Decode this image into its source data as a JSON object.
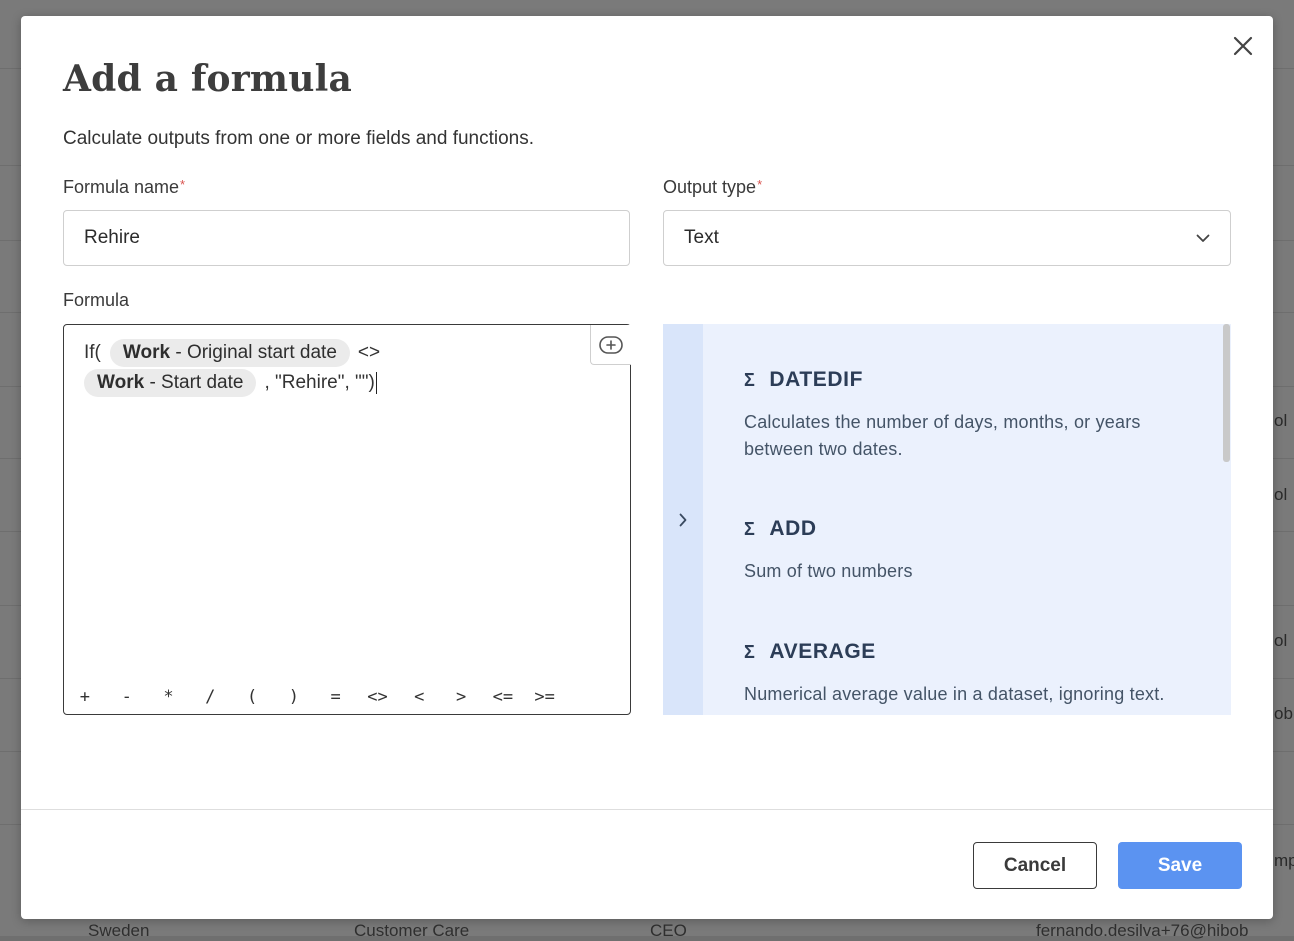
{
  "background": {
    "bottom_row": [
      "Sweden",
      "Customer Care",
      "CEO",
      "fernando.desilva+76@hibob"
    ],
    "edge_fragments": [
      "ol",
      "ol",
      "ol",
      "ob.",
      "mp"
    ]
  },
  "dialog": {
    "title": "Add a formula",
    "subtitle": "Calculate outputs from one or more fields and functions.",
    "formula_name": {
      "label": "Formula name",
      "required_mark": "*",
      "value": "Rehire"
    },
    "output_type": {
      "label": "Output type",
      "required_mark": "*",
      "value": "Text"
    },
    "formula": {
      "label": "Formula",
      "line1_prefix": "If(",
      "chip1": {
        "bold": "Work",
        "rest": " - Original start date"
      },
      "line1_suffix": "<>",
      "chip2": {
        "bold": "Work",
        "rest": " - Start date"
      },
      "line2_suffix": ", \"Rehire\", \"\")",
      "operators": [
        "+",
        "-",
        "*",
        "/",
        "(",
        ")",
        "=",
        "<>",
        "<",
        ">",
        "<=",
        ">="
      ]
    },
    "functions": [
      {
        "name": "DATEDIF",
        "description": "Calculates the number of days, months, or years between two dates."
      },
      {
        "name": "ADD",
        "description": "Sum of two numbers"
      },
      {
        "name": "AVERAGE",
        "description": "Numerical average value in a dataset, ignoring text."
      }
    ],
    "buttons": {
      "cancel": "Cancel",
      "save": "Save"
    }
  },
  "colors": {
    "primary": "#5b93f1",
    "panel_bg": "#ebf1fd",
    "panel_strip": "#d9e5fa",
    "required": "#d9534f"
  }
}
